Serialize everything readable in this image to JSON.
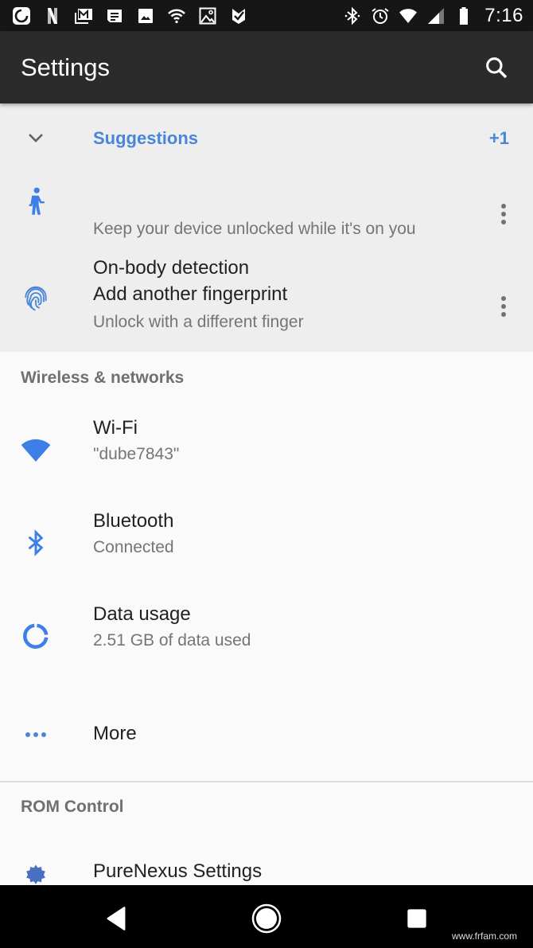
{
  "status_bar": {
    "notification_icons": [
      "sync-ring-icon",
      "netflix-icon",
      "gmail-icon",
      "messages-icon",
      "photo-icon",
      "wifi-icon",
      "gallery-icon",
      "tasks-check-icon"
    ],
    "system_icons": [
      "bluetooth-icon",
      "alarm-icon",
      "wifi-signal-icon",
      "cell-signal-icon",
      "battery-icon"
    ],
    "time": "7:16"
  },
  "app_bar": {
    "title": "Settings",
    "search_icon": "search-icon"
  },
  "suggestions": {
    "label": "Suggestions",
    "count": "+1",
    "items": [
      {
        "icon": "walking-person-icon",
        "title": "On-body detection",
        "subtitle": "Keep your device unlocked while it's on you"
      },
      {
        "icon": "fingerprint-icon",
        "title": "Add another fingerprint",
        "subtitle": "Unlock with a different finger"
      }
    ]
  },
  "sections": [
    {
      "header": "Wireless & networks",
      "items": [
        {
          "icon": "wifi-icon",
          "title": "Wi-Fi",
          "subtitle": "\"dube7843\""
        },
        {
          "icon": "bluetooth-icon",
          "title": "Bluetooth",
          "subtitle": "Connected"
        },
        {
          "icon": "data-usage-icon",
          "title": "Data usage",
          "subtitle": "2.51 GB of data used"
        },
        {
          "icon": "more-horiz-icon",
          "title": "More"
        }
      ]
    },
    {
      "header": "ROM Control",
      "items": [
        {
          "icon": "settings-icon",
          "title": "PureNexus Settings"
        }
      ]
    }
  ],
  "nav_bar": {
    "back": "back-icon",
    "home": "home-icon",
    "recents": "recents-icon"
  },
  "watermark": "www.frfam.com",
  "colors": {
    "accent": "#4a86d8",
    "icon_blue": "#3d7fe6",
    "app_bar": "#2b2b2b",
    "status_bar": "#161616",
    "suggestions_bg": "#eeeeee",
    "page_bg": "#fafafa"
  }
}
